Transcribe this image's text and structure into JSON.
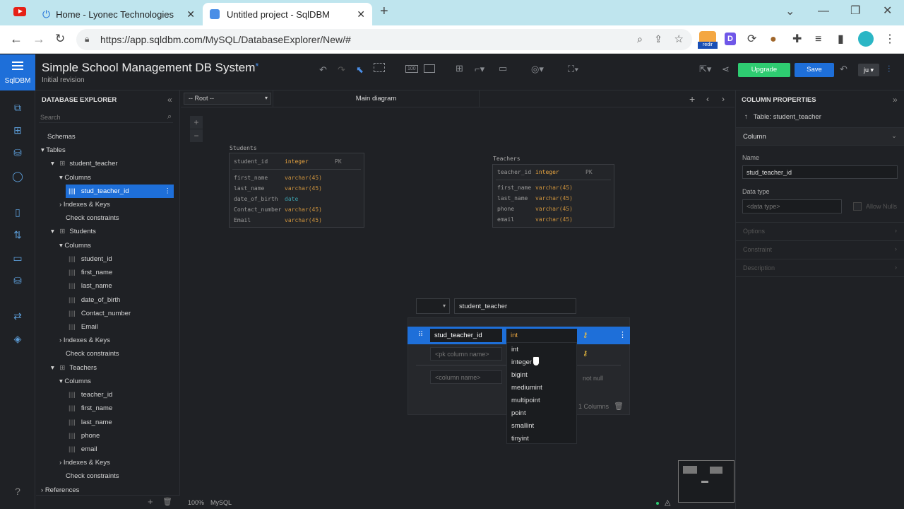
{
  "browser": {
    "tabs": [
      {
        "title": "Home - Lyonec Technologies"
      },
      {
        "title": "Untitled project - SqlDBM"
      }
    ],
    "url": "https://app.sqldbm.com/MySQL/DatabaseExplorer/New/#"
  },
  "app": {
    "logo_label": "SqlDBM",
    "project_title": "Simple School Management DB System",
    "title_marker": "*",
    "revision": "Initial revision",
    "upgrade_label": "Upgrade",
    "save_label": "Save",
    "user_label": "ju",
    "colors": {
      "accent": "#1e6fd9",
      "upgrade": "#2ecc71",
      "type_orange": "#e8a440",
      "type_teal": "#41b6c4"
    }
  },
  "explorer": {
    "title": "DATABASE EXPLORER",
    "search_placeholder": "Search",
    "items": {
      "schemas": "Schemas",
      "tables": "Tables",
      "t1": "student_teacher",
      "t1_columns": "Columns",
      "t1_c1": "stud_teacher_id",
      "t1_idx": "Indexes & Keys",
      "t1_check": "Check constraints",
      "t2": "Students",
      "t2_columns": "Columns",
      "t2_c1": "student_id",
      "t2_c2": "first_name",
      "t2_c3": "last_name",
      "t2_c4": "date_of_birth",
      "t2_c5": "Contact_number",
      "t2_c6": "Email",
      "t2_idx": "Indexes & Keys",
      "t2_check": "Check constraints",
      "t3": "Teachers",
      "t3_columns": "Columns",
      "t3_c1": "teacher_id",
      "t3_c2": "first_name",
      "t3_c3": "last_name",
      "t3_c4": "phone",
      "t3_c5": "email",
      "t3_idx": "Indexes & Keys",
      "t3_check": "Check constraints",
      "references": "References"
    }
  },
  "canvas": {
    "root_select": "-- Root --",
    "diagram_name": "Main diagram",
    "zoom": "100%",
    "db_type": "MySQL",
    "students": {
      "title": "Students",
      "pk_name": "student_id",
      "pk_type": "integer",
      "pk_label": "PK",
      "cols": [
        [
          "first_name",
          "varchar(45)"
        ],
        [
          "last_name",
          "varchar(45)"
        ],
        [
          "date_of_birth",
          "date"
        ],
        [
          "Contact_number",
          "varchar(45)"
        ],
        [
          "Email",
          "varchar(45)"
        ]
      ]
    },
    "teachers": {
      "title": "Teachers",
      "pk_name": "teacher_id",
      "pk_type": "integer",
      "pk_label": "PK",
      "cols": [
        [
          "first_name",
          "varchar(45)"
        ],
        [
          "last_name",
          "varchar(45)"
        ],
        [
          "phone",
          "varchar(45)"
        ],
        [
          "email",
          "varchar(45)"
        ]
      ]
    },
    "editor": {
      "table_name": "student_teacher",
      "col_name": "stud_teacher_id",
      "col_type": "int",
      "pk_placeholder": "<pk column name>",
      "col_placeholder": "<column name>",
      "not_null": "not null",
      "columns_count": "1 Columns"
    },
    "type_options": [
      "int",
      "integer",
      "bigint",
      "mediumint",
      "multipoint",
      "point",
      "smallint",
      "tinyint"
    ]
  },
  "props": {
    "title": "COLUMN PROPERTIES",
    "table_label": "Table: student_teacher",
    "column_section": "Column",
    "name_label": "Name",
    "name_value": "stud_teacher_id",
    "datatype_label": "Data type",
    "datatype_placeholder": "<data type>",
    "allow_nulls": "Allow Nulls",
    "options": "Options",
    "constraint": "Constraint",
    "description": "Description"
  }
}
